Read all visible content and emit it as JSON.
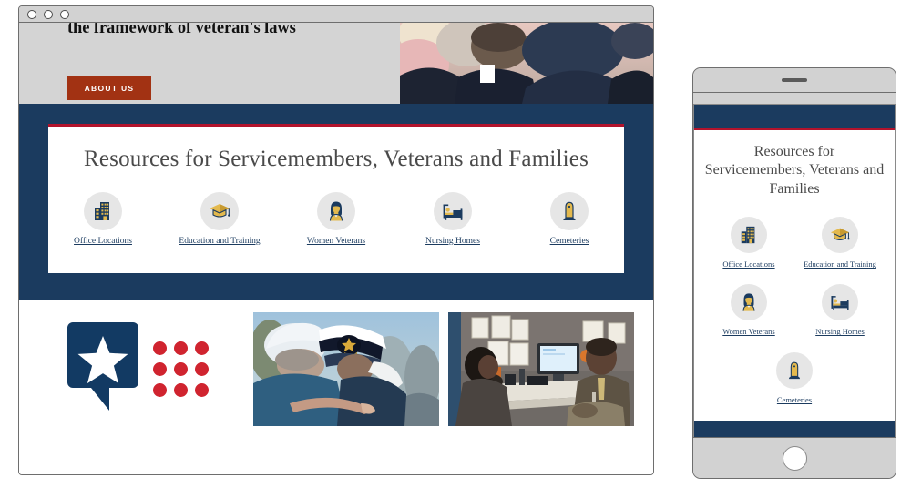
{
  "window": {
    "traffic_lights": [
      "close",
      "minimize",
      "maximize"
    ]
  },
  "hero": {
    "headline_fragment": "the framework of veteran's laws",
    "cta_label": "ABOUT US",
    "photo_alt": "seated audience of veterans in suits"
  },
  "resources": {
    "title": "Resources for Servicemembers, Veterans and Families",
    "accent_color": "#b3132c",
    "band_color": "#1b3b5f",
    "items": [
      {
        "label": "Office Locations",
        "icon": "office-building-icon"
      },
      {
        "label": "Education and Training",
        "icon": "graduation-cap-icon"
      },
      {
        "label": "Women Veterans",
        "icon": "woman-veteran-icon"
      },
      {
        "label": "Nursing Homes",
        "icon": "hospital-bed-icon"
      },
      {
        "label": "Cemeteries",
        "icon": "headstone-icon"
      }
    ]
  },
  "footer": {
    "logo_alt": "navy speech bubble with white star",
    "dot_color": "#d0242f",
    "dot_count": 9,
    "photos": [
      {
        "alt": "veteran embracing a naval officer in white cap"
      },
      {
        "alt": "counselor meeting with a veteran in an office"
      }
    ]
  },
  "mobile": {
    "title": "Resources for Servicemembers, Veterans and Families",
    "items": [
      {
        "label": "Office Locations",
        "icon": "office-building-icon"
      },
      {
        "label": "Education and Training",
        "icon": "graduation-cap-icon"
      },
      {
        "label": "Women Veterans",
        "icon": "woman-veteran-icon"
      },
      {
        "label": "Nursing Homes",
        "icon": "hospital-bed-icon"
      },
      {
        "label": "Cemeteries",
        "icon": "headstone-icon"
      }
    ]
  }
}
